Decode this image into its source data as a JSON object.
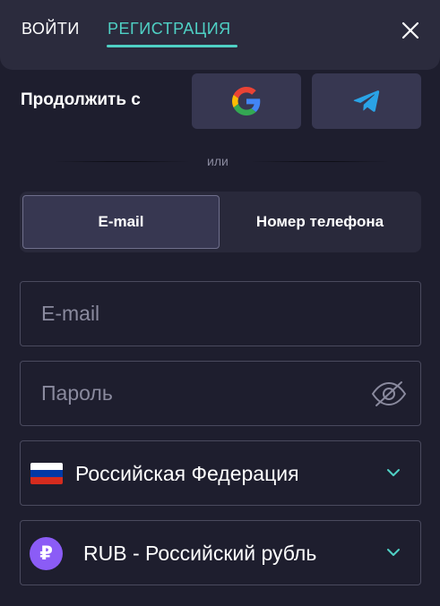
{
  "header": {
    "tabs": [
      {
        "label": "ВОЙТИ",
        "active": false
      },
      {
        "label": "РЕГИСТРАЦИЯ",
        "active": true
      }
    ],
    "close_icon": "close-icon",
    "accent_color": "#4fd1c5"
  },
  "social": {
    "label": "Продолжить с",
    "buttons": [
      {
        "icon": "google-icon"
      },
      {
        "icon": "telegram-icon"
      }
    ]
  },
  "divider": {
    "text": "или"
  },
  "method_switch": {
    "options": [
      {
        "label": "E-mail",
        "selected": true
      },
      {
        "label": "Номер телефона",
        "selected": false
      }
    ]
  },
  "form": {
    "email": {
      "placeholder": "E-mail",
      "value": ""
    },
    "password": {
      "placeholder": "Пароль",
      "value": "",
      "icon": "eye-off-icon"
    },
    "country": {
      "value": "Российская Федерация",
      "icon": "russia-flag-icon"
    },
    "currency": {
      "value": "RUB - Российский рубль",
      "symbol": "₽",
      "symbol_color": "#8b5cf6"
    }
  }
}
